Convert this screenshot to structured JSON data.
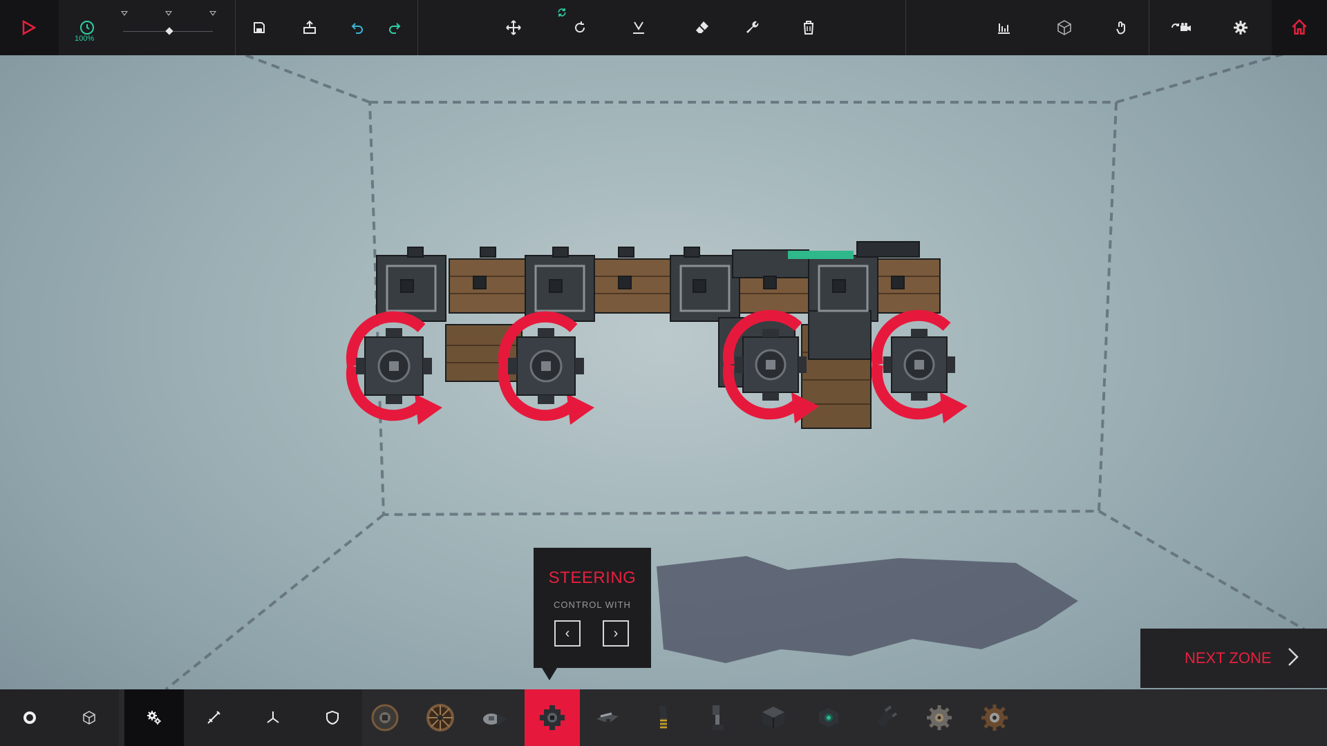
{
  "top_toolbar": {
    "speed_label": "100%",
    "speed_value_percent": 100,
    "icons": {
      "play": "play-icon",
      "clock": "clock-icon",
      "save": "save-icon",
      "load": "load-icon",
      "undo": "undo-icon",
      "redo": "redo-icon",
      "translate": "move-icon",
      "rotate": "rotate-icon",
      "flip": "flip-icon",
      "eraser": "eraser-icon",
      "wrench": "wrench-icon",
      "delete": "trash-icon",
      "stats": "stats-icon",
      "block_view": "cube-icon",
      "grab": "grab-icon",
      "camera": "camera-icon",
      "settings": "gear-icon",
      "home": "home-icon"
    },
    "accent_colors": {
      "play": "#e8203e",
      "speed": "#2ecfa4",
      "home": "#e8203e"
    }
  },
  "tooltip": {
    "title": "STEERING",
    "subtitle": "CONTROL WITH",
    "key_left": "‹",
    "key_right": "›"
  },
  "next_zone": {
    "label": "NEXT ZONE",
    "chevron": "›"
  },
  "bottom_bar": {
    "categories": [
      {
        "icon": "ring-icon"
      },
      {
        "icon": "block-icon"
      },
      {
        "icon": "mechanical-gears-icon",
        "active": true
      },
      {
        "icon": "weapon-icon"
      },
      {
        "icon": "flight-icon"
      },
      {
        "icon": "armour-shield-icon"
      }
    ],
    "blocks": [
      {
        "icon": "wheel-icon"
      },
      {
        "icon": "spoked-wheel-icon"
      },
      {
        "icon": "hinge-icon"
      },
      {
        "icon": "steering-block-icon",
        "active": true
      },
      {
        "icon": "steering-hinge-icon"
      },
      {
        "icon": "piston-icon"
      },
      {
        "icon": "suspension-icon"
      },
      {
        "icon": "cube-block-icon"
      },
      {
        "icon": "rotating-block-icon"
      },
      {
        "icon": "grabber-icon"
      },
      {
        "icon": "small-gear-icon"
      },
      {
        "icon": "large-gear-icon"
      }
    ]
  },
  "colors": {
    "accent": "#e6193c",
    "toolbar_bg": "#1c1c1e",
    "sky": "#a4b7bb"
  }
}
